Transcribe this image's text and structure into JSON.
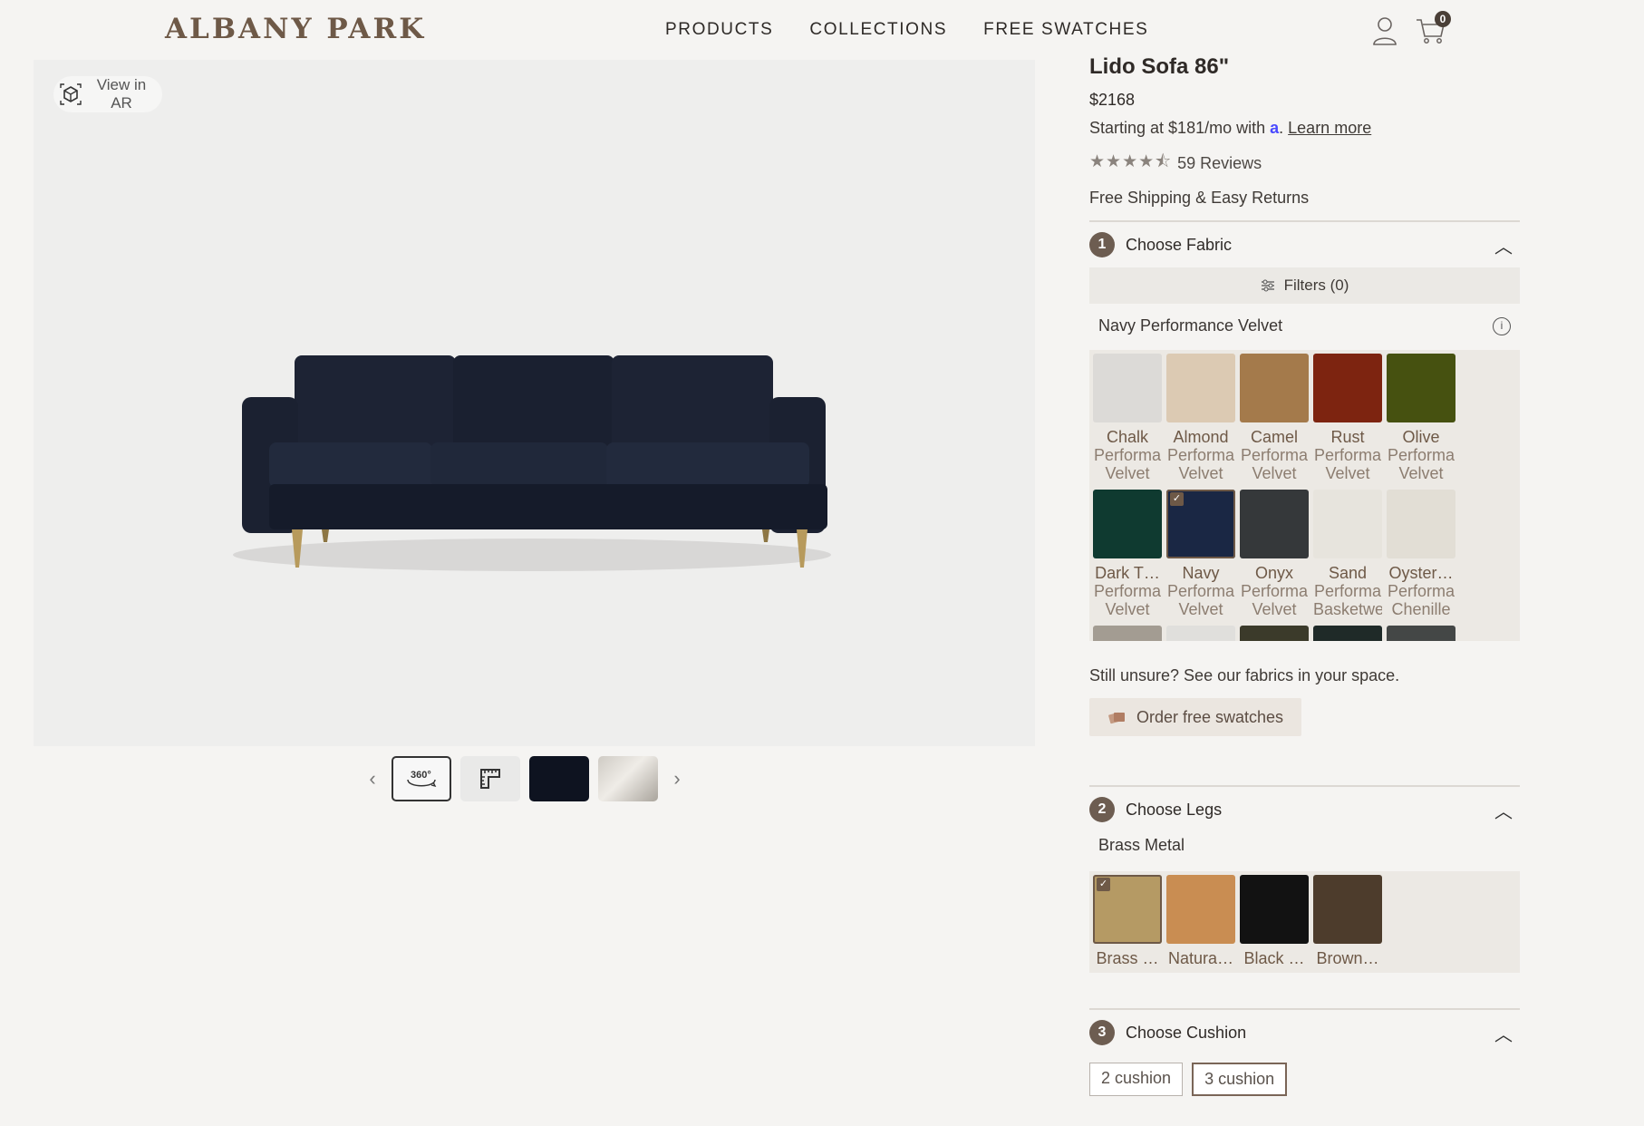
{
  "brand": "ALBANY PARK",
  "nav": [
    "PRODUCTS",
    "COLLECTIONS",
    "FREE SWATCHES"
  ],
  "cart_count": "0",
  "gallery": {
    "ar_label": "View in AR",
    "thumb_360_label": "360°"
  },
  "product": {
    "title": "Lido Sofa 86\"",
    "price": "$2168",
    "finance_prefix": "Starting at $181/mo with",
    "finance_logo": "a",
    "learn_more": "Learn more",
    "stars": "★★★★⯪",
    "reviews": "59 Reviews",
    "shipping": "Free Shipping & Easy Returns"
  },
  "fabric_section": {
    "number": "1",
    "title": "Choose Fabric",
    "filters": "Filters (0)",
    "selected": "Navy Performance Velvet",
    "swatches": [
      {
        "name": "Chalk",
        "sub1": "Performa",
        "sub2": "Velvet",
        "color": "#dcdad7"
      },
      {
        "name": "Almond",
        "sub1": "Performa",
        "sub2": "Velvet",
        "color": "#dccab3"
      },
      {
        "name": "Camel",
        "sub1": "Performa",
        "sub2": "Velvet",
        "color": "#a47a4b"
      },
      {
        "name": "Rust",
        "sub1": "Performa",
        "sub2": "Velvet",
        "color": "#7d2410"
      },
      {
        "name": "Olive",
        "sub1": "Performa",
        "sub2": "Velvet",
        "color": "#465110"
      },
      {
        "name": "Dark T…",
        "sub1": "Performa",
        "sub2": "Velvet",
        "color": "#0f3a30"
      },
      {
        "name": "Navy",
        "sub1": "Performa",
        "sub2": "Velvet",
        "color": "#1a2744"
      },
      {
        "name": "Onyx",
        "sub1": "Performa",
        "sub2": "Velvet",
        "color": "#35383a"
      },
      {
        "name": "Sand",
        "sub1": "Performa",
        "sub2": "Basketwe",
        "color": "#e7e4dd"
      },
      {
        "name": "Oyster…",
        "sub1": "Performa",
        "sub2": "Chenille",
        "color": "#e2ded5"
      }
    ],
    "selected_index": 6,
    "unsure": "Still unsure? See our fabrics in your space.",
    "order_swatches": "Order free swatches"
  },
  "legs_section": {
    "number": "2",
    "title": "Choose Legs",
    "selected": "Brass Metal",
    "swatches": [
      {
        "name": "Brass …",
        "color": "#b59a64"
      },
      {
        "name": "Natura…",
        "color": "#c98d52"
      },
      {
        "name": "Black …",
        "color": "#121212"
      },
      {
        "name": "Brown…",
        "color": "#4d3c2c"
      }
    ],
    "selected_index": 0
  },
  "cushion_section": {
    "number": "3",
    "title": "Choose Cushion",
    "options": [
      "2 cushion",
      "3 cushion"
    ],
    "selected_index": 1
  }
}
